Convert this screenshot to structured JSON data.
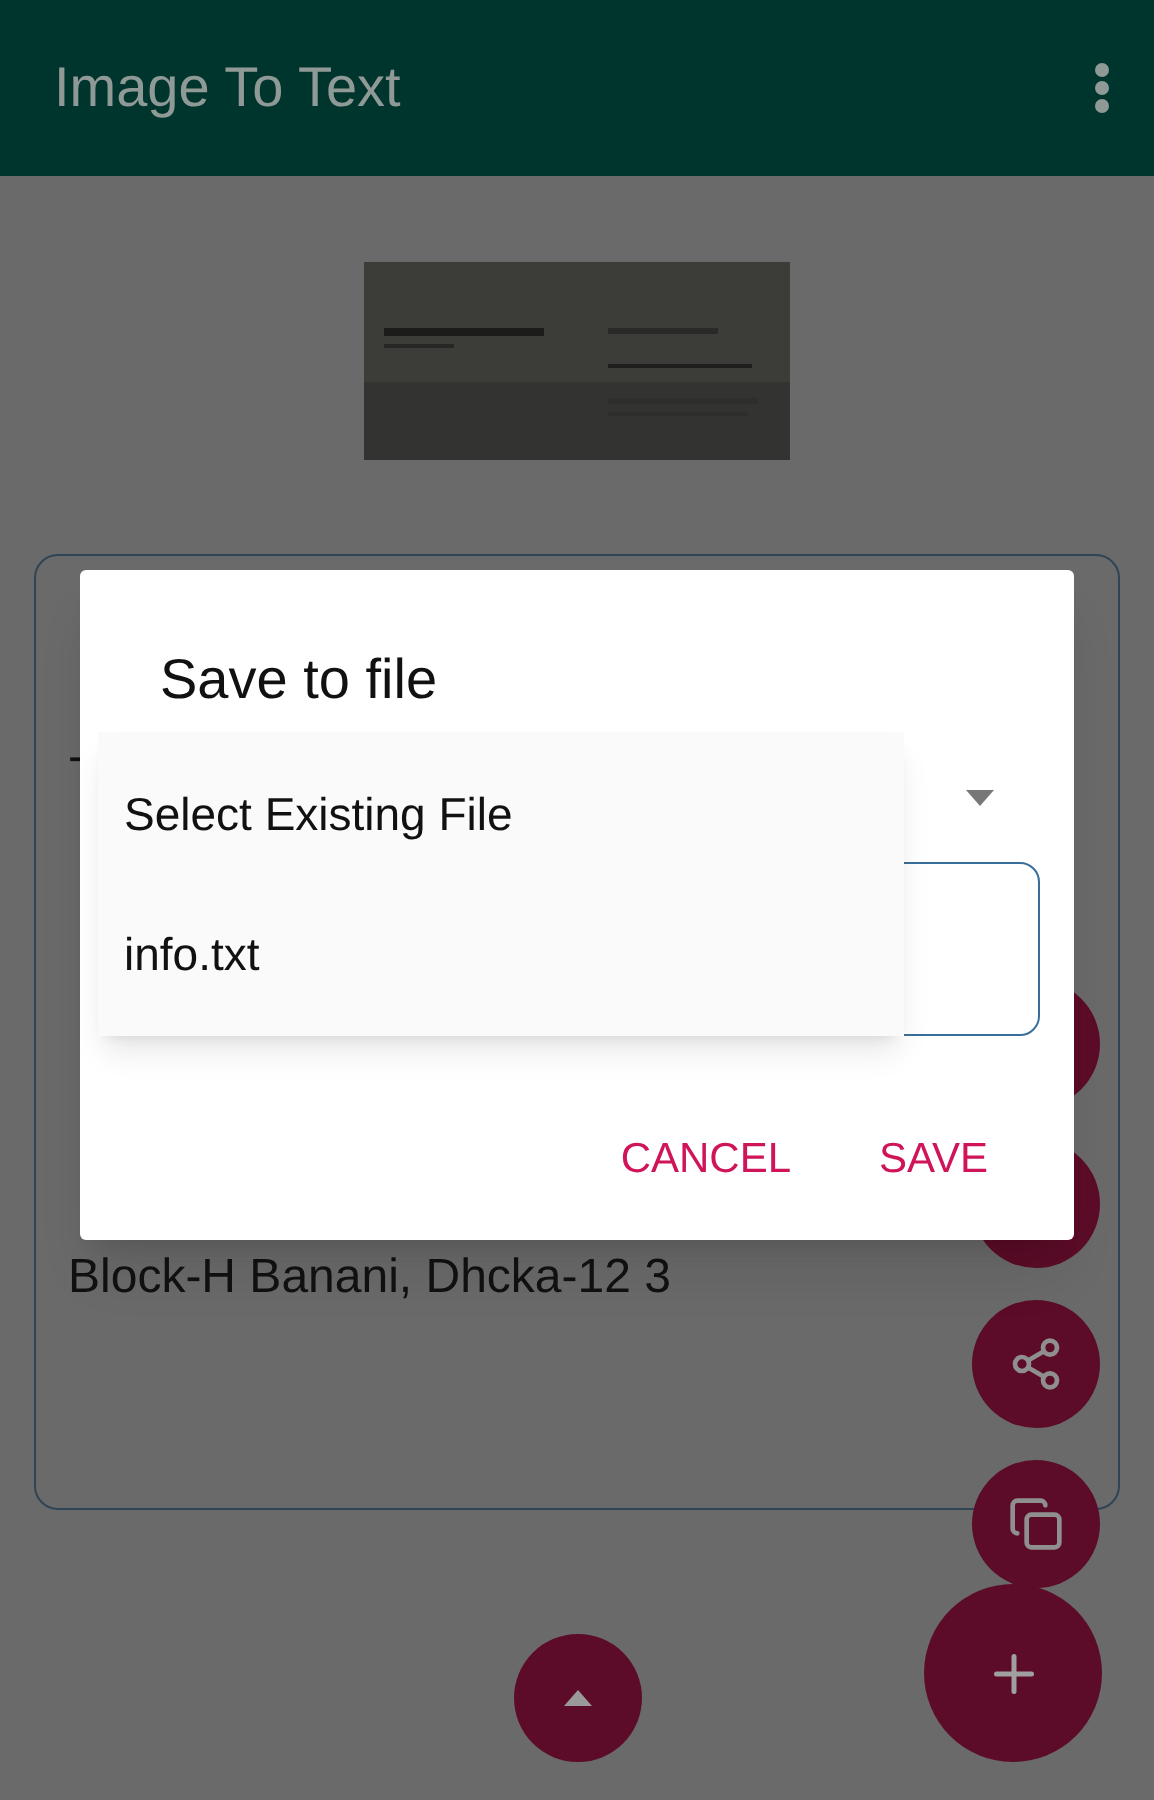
{
  "app_bar": {
    "title": "Image To Text"
  },
  "text_box": {
    "lines": [
      "-",
      "Block-H Banani, Dhcka-12 3"
    ]
  },
  "dialog": {
    "title": "Save to file",
    "buttons": [
      "CANCEL",
      "SAVE"
    ]
  },
  "dropdown_menu": {
    "items": [
      {
        "label": "Select Existing File"
      },
      {
        "label": "info.txt"
      }
    ]
  }
}
